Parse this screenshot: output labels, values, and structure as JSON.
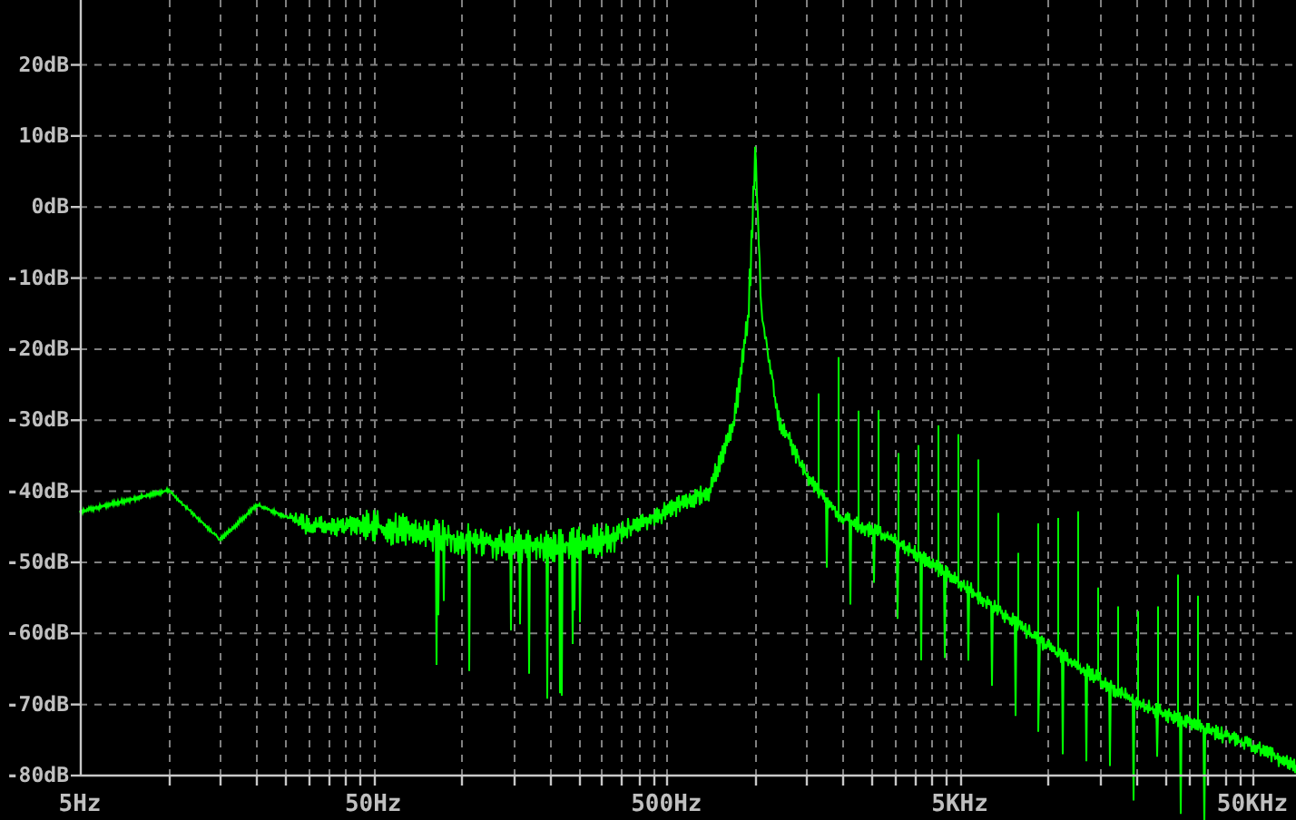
{
  "plot": {
    "y_axis_labels": [
      "20dB",
      "10dB",
      "0dB",
      "-10dB",
      "-20dB",
      "-30dB",
      "-40dB",
      "-50dB",
      "-60dB",
      "-70dB",
      "-80dB"
    ],
    "x_axis_labels": [
      "5Hz",
      "50Hz",
      "500Hz",
      "5KHz",
      "50KHz"
    ]
  }
}
